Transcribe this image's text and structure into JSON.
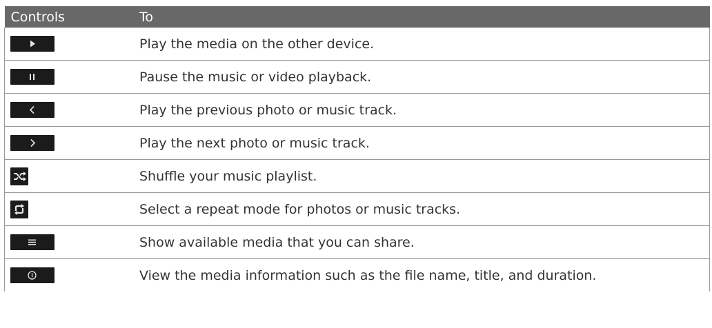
{
  "table": {
    "headers": {
      "controls": "Controls",
      "to": "To"
    },
    "rows": [
      {
        "icon": "play-icon",
        "description": "Play the media on the other device."
      },
      {
        "icon": "pause-icon",
        "description": "Pause the music or video playback."
      },
      {
        "icon": "previous-icon",
        "description": "Play the previous photo or music track."
      },
      {
        "icon": "next-icon",
        "description": "Play the next photo or music track."
      },
      {
        "icon": "shuffle-icon",
        "description": "Shuffle your music playlist."
      },
      {
        "icon": "repeat-icon",
        "description": "Select a repeat mode for photos or music tracks."
      },
      {
        "icon": "menu-list-icon",
        "description": "Show available media that you can share."
      },
      {
        "icon": "info-icon",
        "description": "View the media information such as the file name, title, and duration."
      }
    ]
  },
  "colors": {
    "header_bg": "#686868",
    "header_text": "#ffffff",
    "body_text": "#333333",
    "button_bg": "#1b1b1b",
    "button_glyph": "#e6e6e6",
    "border": "#9a9a9a"
  }
}
